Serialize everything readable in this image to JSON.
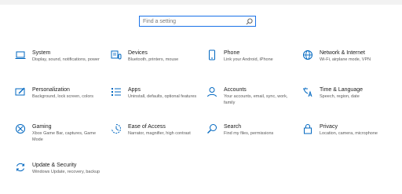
{
  "search": {
    "placeholder": "Find a setting"
  },
  "items": [
    {
      "title": "System",
      "description": "Display, sound, notifications, power",
      "icon": "laptop-icon"
    },
    {
      "title": "Devices",
      "description": "Bluetooth, printers, mouse",
      "icon": "keyboard-devices-icon"
    },
    {
      "title": "Phone",
      "description": "Link your Android, iPhone",
      "icon": "phone-icon"
    },
    {
      "title": "Network & Internet",
      "description": "Wi-Fi, airplane mode, VPN",
      "icon": "globe-icon"
    },
    {
      "title": "Personalization",
      "description": "Background, lock screen, colors",
      "icon": "paint-brush-screen-icon"
    },
    {
      "title": "Apps",
      "description": "Uninstall, defaults, optional features",
      "icon": "apps-list-icon"
    },
    {
      "title": "Accounts",
      "description": "Your accounts, email, sync, work, family",
      "icon": "person-icon"
    },
    {
      "title": "Time & Language",
      "description": "Speech, region, date",
      "icon": "time-language-icon"
    },
    {
      "title": "Gaming",
      "description": "Xbox Game Bar, captures, Game Mode",
      "icon": "xbox-icon"
    },
    {
      "title": "Ease of Access",
      "description": "Narrator, magnifier, high contrast",
      "icon": "ease-of-access-icon"
    },
    {
      "title": "Search",
      "description": "Find my files, permissions",
      "icon": "search-icon"
    },
    {
      "title": "Privacy",
      "description": "Location, camera, microphone",
      "icon": "lock-icon"
    },
    {
      "title": "Update & Security",
      "description": "Windows Update, recovery, backup",
      "icon": "sync-arrows-icon"
    }
  ],
  "colors": {
    "accent": "#0067c0",
    "focus_border": "#1a73e8",
    "title_text": "#1a1a1a",
    "desc_text": "#5a5a5a"
  }
}
